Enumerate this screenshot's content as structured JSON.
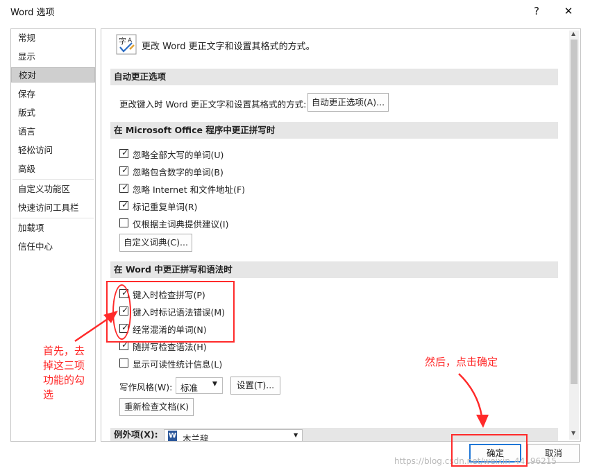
{
  "window": {
    "title": "Word 选项",
    "help_glyph": "?",
    "close_glyph": "✕"
  },
  "sidebar": {
    "items": [
      {
        "label": "常规"
      },
      {
        "label": "显示"
      },
      {
        "label": "校对"
      },
      {
        "label": "保存"
      },
      {
        "label": "版式"
      },
      {
        "label": "语言"
      },
      {
        "label": "轻松访问"
      },
      {
        "label": "高级"
      },
      {
        "label": "自定义功能区"
      },
      {
        "label": "快速访问工具栏"
      },
      {
        "label": "加载项"
      },
      {
        "label": "信任中心"
      }
    ],
    "selected": "校对"
  },
  "main": {
    "header_text": "更改 Word 更正文字和设置其格式的方式。",
    "header_icon": "proofing-abc-check-icon",
    "autocorrect": {
      "section_title": "自动更正选项",
      "label": "更改键入时 Word 更正文字和设置其格式的方式:",
      "button_label": "自动更正选项(A)..."
    },
    "office": {
      "section_title": "在 Microsoft Office 程序中更正拼写时",
      "options": [
        {
          "label": "忽略全部大写的单词(U)",
          "checked": true
        },
        {
          "label": "忽略包含数字的单词(B)",
          "checked": true
        },
        {
          "label": "忽略 Internet 和文件地址(F)",
          "checked": true
        },
        {
          "label": "标记重复单词(R)",
          "checked": true
        },
        {
          "label": "仅根据主词典提供建议(I)",
          "checked": false
        }
      ],
      "custom_dict_button": "自定义词典(C)..."
    },
    "word": {
      "section_title": "在 Word 中更正拼写和语法时",
      "options": [
        {
          "label": "键入时检查拼写(P)",
          "checked": true
        },
        {
          "label": "键入时标记语法错误(M)",
          "checked": true
        },
        {
          "label": "经常混淆的单词(N)",
          "checked": true
        },
        {
          "label": "随拼写检查语法(H)",
          "checked": true
        },
        {
          "label": "显示可读性统计信息(L)",
          "checked": false
        }
      ],
      "writing_style_label": "写作风格(W):",
      "writing_style_value": "标准",
      "settings_button": "设置(T)...",
      "recheck_button": "重新检查文档(K)"
    },
    "exceptions": {
      "label": "例外项(X):",
      "doc_name": "木兰辞"
    }
  },
  "footer": {
    "ok_label": "确定",
    "cancel_label": "取消"
  },
  "annotations": {
    "left_note": [
      "首先，去",
      "掉这三项",
      "功能的勾",
      "选"
    ],
    "right_note": "然后，点击确定",
    "color": "#ff2a2a"
  },
  "watermark": "https://blog.csdn.net/weixin_44196215"
}
